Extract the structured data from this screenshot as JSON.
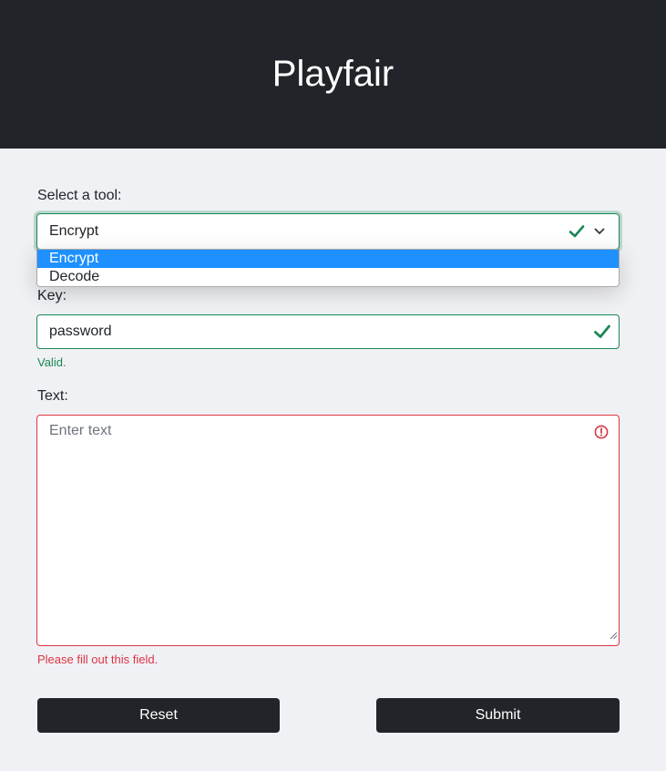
{
  "header": {
    "title": "Playfair"
  },
  "tool_select": {
    "label": "Select a tool:",
    "value": "Encrypt",
    "options": [
      "Encrypt",
      "Decode"
    ],
    "status_icon": "check-icon",
    "chevron_icon": "chevron-down-icon"
  },
  "key_field": {
    "label": "Key:",
    "value": "password",
    "status_icon": "check-icon",
    "feedback": "Valid."
  },
  "text_field": {
    "label": "Text:",
    "placeholder": "Enter text",
    "value": "",
    "status_icon": "exclamation-circle-icon",
    "feedback": "Please fill out this field."
  },
  "buttons": {
    "reset_label": "Reset",
    "submit_label": "Submit"
  },
  "colors": {
    "header_bg": "#212529",
    "page_bg": "#f0f1f5",
    "valid": "#198754",
    "invalid": "#dc3545",
    "option_highlight": "#1e90ff",
    "button_bg": "#212529"
  }
}
